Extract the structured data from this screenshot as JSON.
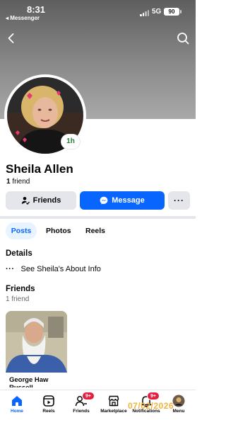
{
  "status_bar": {
    "time": "8:31",
    "back_app": "◂ Messenger",
    "network": "5G",
    "battery": "90"
  },
  "colors": {
    "accent": "#0866ff",
    "badge": "#e41e3f",
    "active_text": "#1f7d34",
    "stamp": "#f0b43a"
  },
  "profile": {
    "name": "Sheila Allen",
    "active_badge": "1h",
    "friend_count": "1",
    "friend_word": "friend"
  },
  "actions": {
    "friends_label": "Friends",
    "message_label": "Message",
    "more_label": "···"
  },
  "tabs": [
    {
      "label": "Posts",
      "active": true
    },
    {
      "label": "Photos",
      "active": false
    },
    {
      "label": "Reels",
      "active": false
    }
  ],
  "details": {
    "title": "Details",
    "about_link": "See Sheila's About Info",
    "icon": "more-dots-icon"
  },
  "friends_section": {
    "title": "Friends",
    "subtitle": "1 friend",
    "cards": [
      {
        "name": "George Haw Russell"
      }
    ]
  },
  "bottom_nav": [
    {
      "label": "Home",
      "icon": "home-icon",
      "active": true
    },
    {
      "label": "Reels",
      "icon": "reels-icon",
      "active": false
    },
    {
      "label": "Friends",
      "icon": "friends-icon",
      "active": false,
      "badge": "9+"
    },
    {
      "label": "Marketplace",
      "icon": "marketplace-icon",
      "active": false
    },
    {
      "label": "Notifications",
      "icon": "bell-icon",
      "active": false,
      "badge": "9+"
    },
    {
      "label": "Menu",
      "icon": "avatar-icon",
      "active": false
    }
  ],
  "watermark_date": "07/02/2026"
}
